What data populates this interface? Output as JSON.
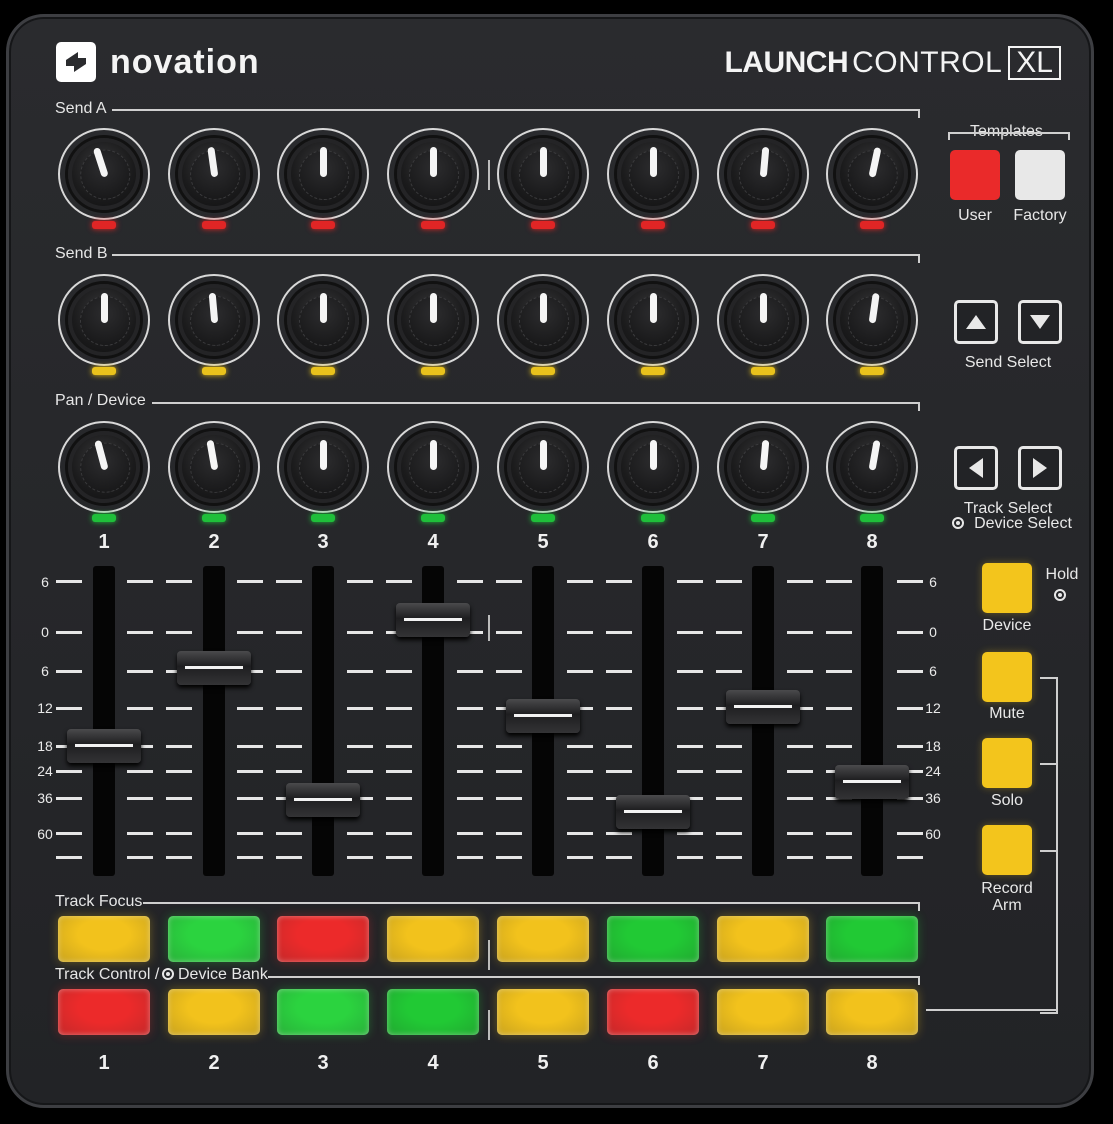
{
  "brand": {
    "name": "novation"
  },
  "product": {
    "bold": "LAUNCH",
    "light": "CONTROL",
    "suffix": "XL"
  },
  "sections": {
    "send_a": "Send A",
    "send_b": "Send B",
    "pan_device": "Pan / Device",
    "track_focus": "Track Focus",
    "track_control": "Track Control /",
    "device_bank": "Device Bank"
  },
  "channels": [
    "1",
    "2",
    "3",
    "4",
    "5",
    "6",
    "7",
    "8"
  ],
  "knob_rows": [
    {
      "name": "send-a",
      "led_color": "#e02525",
      "angles": [
        -18,
        -8,
        0,
        0,
        0,
        0,
        5,
        12
      ]
    },
    {
      "name": "send-b",
      "led_color": "#e9c21c",
      "angles": [
        0,
        -5,
        0,
        0,
        0,
        0,
        0,
        8
      ]
    },
    {
      "name": "pan-device",
      "led_color": "#1fbf3a",
      "angles": [
        -15,
        -10,
        0,
        0,
        0,
        0,
        5,
        10
      ]
    }
  ],
  "fader_scale_left": [
    "6",
    "0",
    "6",
    "12",
    "18",
    "24",
    "36",
    "60"
  ],
  "fader_scale_right": [
    "6",
    "0",
    "6",
    "12",
    "18",
    "24",
    "36",
    "60"
  ],
  "fader_levels": [
    0.4,
    0.66,
    0.22,
    0.82,
    0.5,
    0.18,
    0.53,
    0.28
  ],
  "track_focus_pads": [
    "#f2c21c",
    "#2bd33f",
    "#ec2a2a",
    "#f2c21c",
    "#f2c21c",
    "#21c934",
    "#f2c21c",
    "#21c934"
  ],
  "track_control_pads": [
    "#ec2a2a",
    "#f2c21c",
    "#2bd33f",
    "#21c934",
    "#f2c21c",
    "#ec2a2a",
    "#f2c21c",
    "#f2c21c"
  ],
  "templates": {
    "title": "Templates",
    "user": "User",
    "factory": "Factory",
    "user_color": "#ea2a2a",
    "factory_color": "#e8e8e8"
  },
  "send_select": {
    "label": "Send Select",
    "up_icon": "arrow-up-icon",
    "down_icon": "arrow-down-icon"
  },
  "track_select": {
    "label": "Track Select",
    "sub_label": "Device Select",
    "left_icon": "arrow-left-icon",
    "right_icon": "arrow-right-icon"
  },
  "side_buttons": {
    "hold": "Hold",
    "device": "Device",
    "mute": "Mute",
    "solo": "Solo",
    "record_arm_1": "Record",
    "record_arm_2": "Arm",
    "color": "#f3c51c"
  }
}
